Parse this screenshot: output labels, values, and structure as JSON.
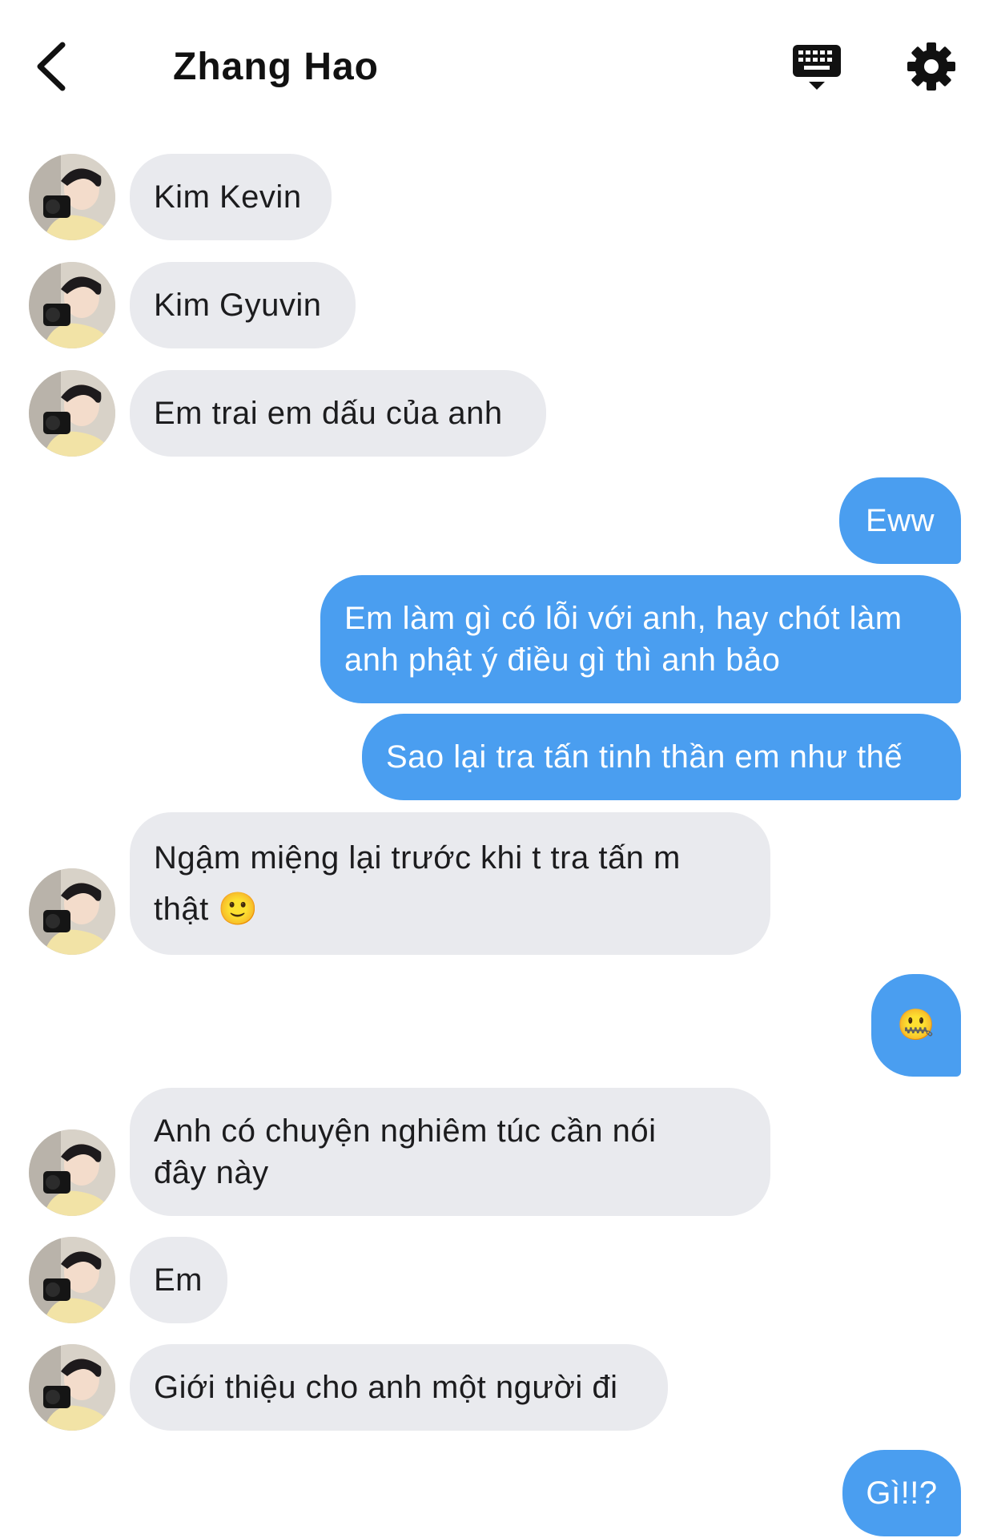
{
  "header": {
    "title": "Zhang Hao"
  },
  "icons": {
    "back": "chevron-left-icon",
    "keyboard": "keyboard-icon",
    "settings": "gear-icon"
  },
  "colors": {
    "outgoing_bubble": "#4a9ef0",
    "incoming_bubble": "#e9eaee"
  },
  "messages": [
    {
      "side": "in",
      "text": "Kim Kevin"
    },
    {
      "side": "in",
      "text": "Kim Gyuvin"
    },
    {
      "side": "in",
      "text": "Em trai em dấu của anh"
    },
    {
      "side": "out",
      "text": "Eww"
    },
    {
      "side": "out",
      "text": "Em làm gì có lỗi với anh, hay chót làm\nanh phật ý điều gì thì anh bảo"
    },
    {
      "side": "out",
      "text": "Sao lại tra tấn tinh thần em như thế"
    },
    {
      "side": "in",
      "text": "Ngậm miệng lại trước khi t tra tấn m\nthật 🙂"
    },
    {
      "side": "out",
      "text": "🤐"
    },
    {
      "side": "in",
      "text": "Anh có chuyện nghiêm túc cần nói\nđây này"
    },
    {
      "side": "in",
      "text": "Em"
    },
    {
      "side": "in",
      "text": "Giới thiệu cho anh một người đi"
    },
    {
      "side": "out",
      "text": "Gì!!?"
    }
  ]
}
